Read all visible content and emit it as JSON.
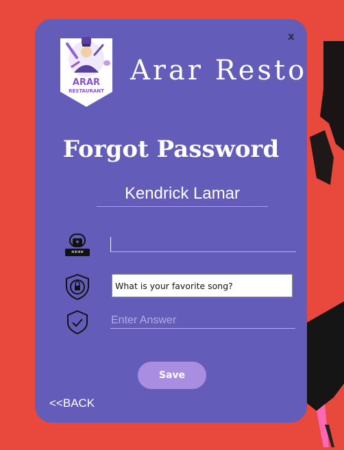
{
  "window": {
    "close_label": "x"
  },
  "brand": {
    "name": "Arar Resto",
    "logo_text_top": "ARAR",
    "logo_text_bottom": "RESTAURANT"
  },
  "page": {
    "title": "Forgot Password"
  },
  "user": {
    "name": "Kendrick Lamar"
  },
  "form": {
    "password_value": "",
    "security_question": "What is your favorite song?",
    "answer_placeholder": "Enter Answer",
    "save_label": "Save"
  },
  "nav": {
    "back_label": "<<BACK"
  },
  "icons": {
    "password": "padlock-password-icon",
    "question": "shield-lock-icon",
    "answer": "shield-check-icon"
  },
  "colors": {
    "background": "#e8493c",
    "panel": "#635cb9",
    "button": "#a98de0",
    "text": "#ffffff"
  }
}
